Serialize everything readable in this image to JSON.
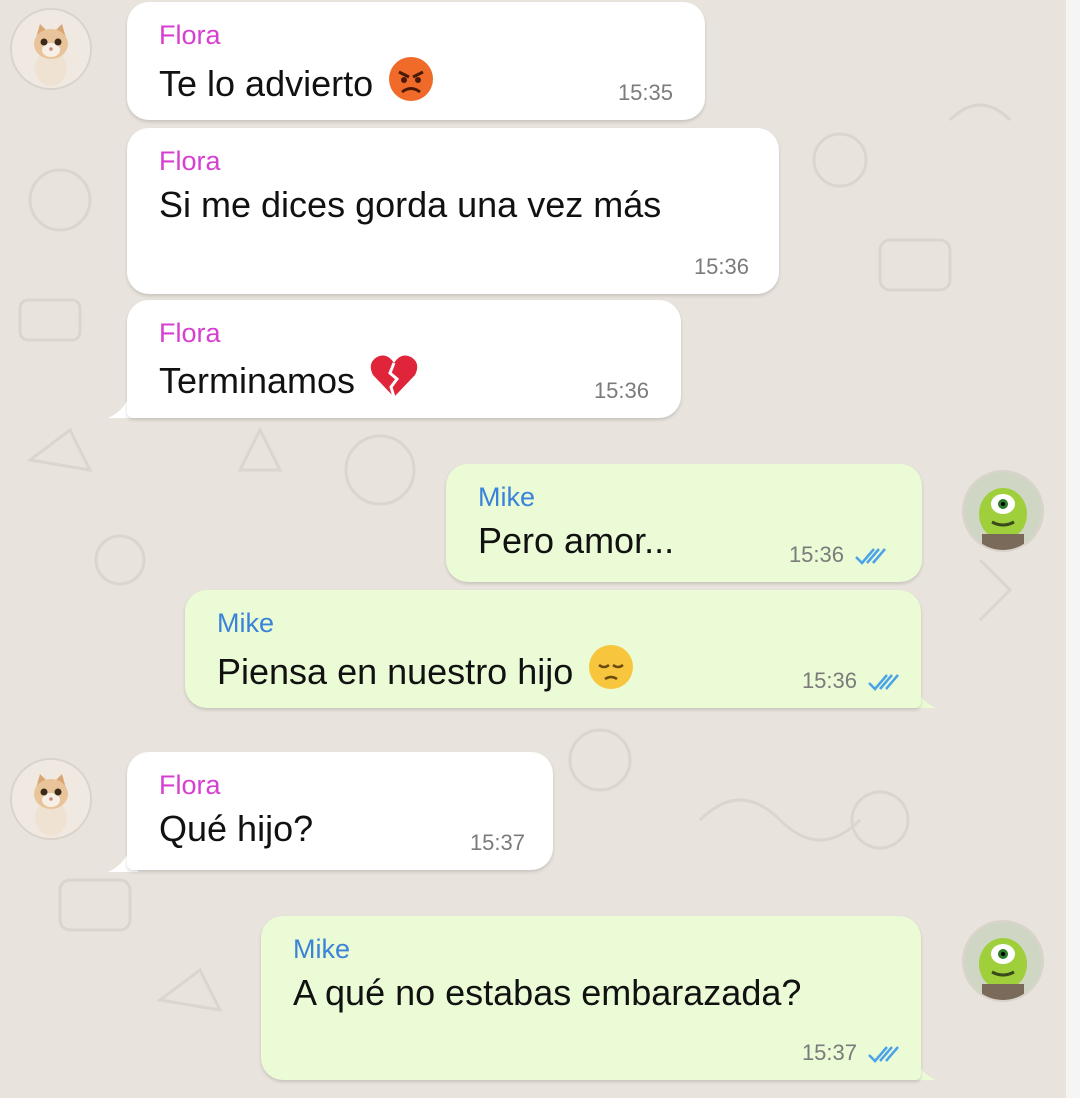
{
  "participants": {
    "flora": "Flora",
    "mike": "Mike"
  },
  "colors": {
    "flora_name": "#d63fd0",
    "mike_name": "#3a83d9",
    "incoming_bubble": "#ffffff",
    "outgoing_bubble": "#eafbd6",
    "read_ticks": "#4aa3e8",
    "wallpaper": "#e8e3dc"
  },
  "messages": [
    {
      "sender": "Flora",
      "text": "Te lo advierto",
      "time": "15:35",
      "emoji": "angry-face"
    },
    {
      "sender": "Flora",
      "text": "Si me dices gorda una vez más",
      "time": "15:36"
    },
    {
      "sender": "Flora",
      "text": "Terminamos",
      "time": "15:36",
      "emoji": "broken-heart"
    },
    {
      "sender": "Mike",
      "text": "Pero amor...",
      "time": "15:36",
      "status": "read"
    },
    {
      "sender": "Mike",
      "text": "Piensa en nuestro hijo",
      "time": "15:36",
      "emoji": "pensive-face",
      "status": "read"
    },
    {
      "sender": "Flora",
      "text": "Qué hijo?",
      "time": "15:37"
    },
    {
      "sender": "Mike",
      "text": "A qué no estabas embarazada?",
      "time": "15:37",
      "status": "read"
    }
  ]
}
